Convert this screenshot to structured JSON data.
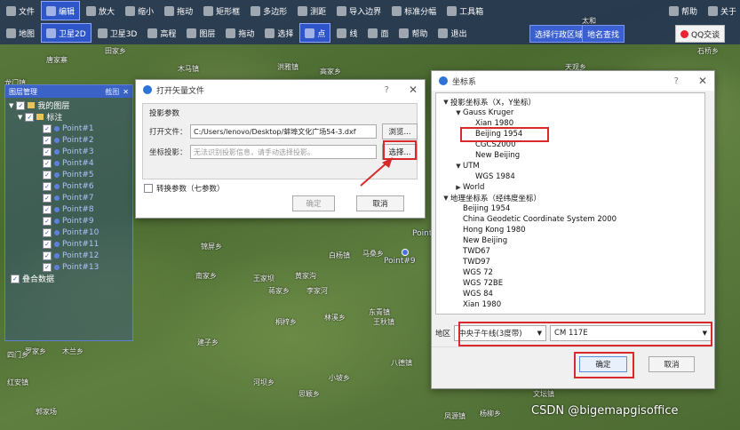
{
  "toolbar": {
    "row1": [
      {
        "label": "文件"
      },
      {
        "label": "编辑",
        "active": true
      },
      {
        "label": "放大"
      },
      {
        "label": "缩小"
      },
      {
        "label": "拖动"
      },
      {
        "label": "矩形框"
      },
      {
        "label": "多边形"
      },
      {
        "label": "测距"
      },
      {
        "label": "导入边界"
      },
      {
        "label": "标准分幅"
      },
      {
        "label": "工具箱"
      }
    ],
    "row1_right": [
      {
        "label": "帮助"
      },
      {
        "label": "关于"
      }
    ],
    "row2": [
      {
        "label": "地图"
      },
      {
        "label": "卫星2D",
        "active": true
      },
      {
        "label": "卫星3D"
      },
      {
        "label": "高程"
      },
      {
        "label": "图层"
      },
      {
        "label": "拖动"
      },
      {
        "label": "选择"
      },
      {
        "label": "点",
        "active": true
      },
      {
        "label": "线"
      },
      {
        "label": "面"
      },
      {
        "label": "帮助"
      },
      {
        "label": "退出"
      }
    ],
    "select_region": "选择行政区域",
    "place_search": "地名查找",
    "qq": "QQ交谈"
  },
  "map_places": [
    "唐家寨",
    "田家乡",
    "木马镇",
    "洪雅镇",
    "高家乡",
    "龙门镇",
    "天观乡",
    "石桥乡",
    "太和",
    "锦屏乡",
    "白杨镇",
    "马桑乡",
    "黄家沟",
    "李家河",
    "南家乡",
    "王家坝",
    "东青镇",
    "王秋镇",
    "蒋家乡",
    "林溪乡",
    "桐梓乡",
    "罗家乡",
    "建子乡",
    "四门乡",
    "八德镇",
    "木兰乡",
    "红安镇",
    "小坡乡",
    "河坝乡",
    "思颖乡",
    "文坛镇",
    "凤源镇",
    "杨柳乡",
    "郭家场"
  ],
  "map_point_labels": [
    "Point",
    "Point#9"
  ],
  "layer_panel": {
    "title": "图层管理",
    "action": "截图",
    "close": "✕",
    "root": "我的图层",
    "group": "标注",
    "points": [
      "Point#1",
      "Point#2",
      "Point#3",
      "Point#4",
      "Point#5",
      "Point#6",
      "Point#7",
      "Point#8",
      "Point#9",
      "Point#10",
      "Point#11",
      "Point#12",
      "Point#13"
    ],
    "combined": "叠合数据"
  },
  "open_dialog": {
    "title": "打开矢量文件",
    "help": "?",
    "close": "✕",
    "section": "投影参数",
    "file_label": "打开文件：",
    "file_value": "C:/Users/lenovo/Desktop/蚌埠文化广场54-3.dxf",
    "browse": "浏览...",
    "proj_label": "坐标投影：",
    "proj_placeholder": "无法识别投影信息，请手动选择投影。",
    "choose": "选择...",
    "convert_label": "转换参数（七参数）",
    "ok": "确定",
    "cancel": "取消"
  },
  "coord_dialog": {
    "title": "坐标系",
    "help": "?",
    "close": "✕",
    "tree": [
      {
        "label": "投影坐标系（X，Y坐标）",
        "level": 0,
        "arrow": "▼"
      },
      {
        "label": "Gauss Kruger",
        "level": 1,
        "arrow": "▼"
      },
      {
        "label": "Xian 1980",
        "level": 2,
        "arrow": ""
      },
      {
        "label": "Beijing 1954",
        "level": 2,
        "arrow": "",
        "selected": true
      },
      {
        "label": "CGCS2000",
        "level": 2,
        "arrow": ""
      },
      {
        "label": "New Beijing",
        "level": 2,
        "arrow": ""
      },
      {
        "label": "UTM",
        "level": 1,
        "arrow": "▼"
      },
      {
        "label": "WGS 1984",
        "level": 2,
        "arrow": ""
      },
      {
        "label": "World",
        "level": 1,
        "arrow": "▶"
      },
      {
        "label": "地理坐标系（经纬度坐标）",
        "level": 0,
        "arrow": "▼"
      },
      {
        "label": "Beijing 1954",
        "level": 1,
        "arrow": ""
      },
      {
        "label": "China Geodetic Coordinate System 2000",
        "level": 1,
        "arrow": ""
      },
      {
        "label": "Hong Kong 1980",
        "level": 1,
        "arrow": ""
      },
      {
        "label": "New Beijing",
        "level": 1,
        "arrow": ""
      },
      {
        "label": "TWD67",
        "level": 1,
        "arrow": ""
      },
      {
        "label": "TWD97",
        "level": 1,
        "arrow": ""
      },
      {
        "label": "WGS 72",
        "level": 1,
        "arrow": ""
      },
      {
        "label": "WGS 72BE",
        "level": 1,
        "arrow": ""
      },
      {
        "label": "WGS 84",
        "level": 1,
        "arrow": ""
      },
      {
        "label": "Xian 1980",
        "level": 1,
        "arrow": ""
      }
    ],
    "region_label": "地区",
    "zone_value": "中央子午线(3度带)",
    "cm_value": "CM 117E",
    "ok": "确定",
    "cancel": "取消"
  },
  "watermark": "CSDN @bigemapgisoffice",
  "colors": {
    "accent": "#3b62c7",
    "highlight": "#d82a2a",
    "toolbar": "#1c285a"
  }
}
